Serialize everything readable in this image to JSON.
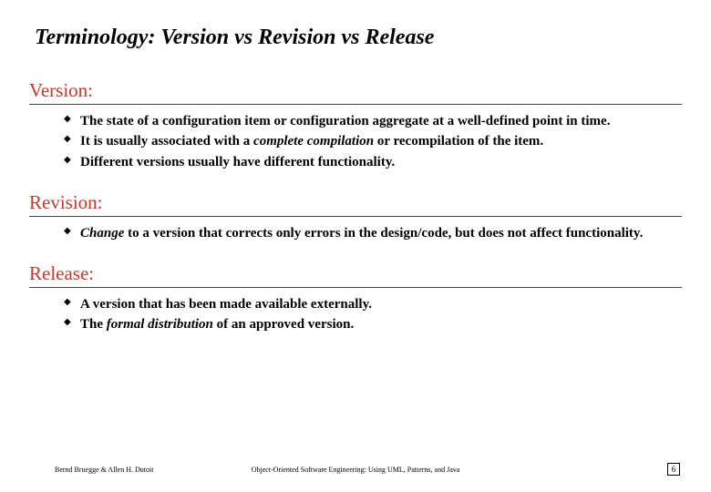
{
  "title": "Terminology: Version vs Revision vs Release",
  "sections": [
    {
      "heading": "Version:",
      "items": [
        {
          "pre": "The state of a configuration item or configuration aggregate at a well-defined point in time."
        },
        {
          "pre": "It is usually associated with a ",
          "em": "complete compilation",
          "post": " or recompilation of the item."
        },
        {
          "pre": "Different versions usually have different functionality."
        }
      ]
    },
    {
      "heading": "Revision:",
      "items": [
        {
          "em": "Change",
          "post": " to a version that corrects only errors in the design/code, but does not affect functionality."
        }
      ]
    },
    {
      "heading": "Release:",
      "items": [
        {
          "pre": "A version that has been made available externally."
        },
        {
          "pre": "The ",
          "em": " formal distribution",
          "post": " of an approved version."
        }
      ]
    }
  ],
  "footer": {
    "left": "Bernd Bruegge & Allen H. Dutoit",
    "center": "Object-Oriented Software Engineering: Using UML, Patterns, and Java",
    "page": "6"
  }
}
